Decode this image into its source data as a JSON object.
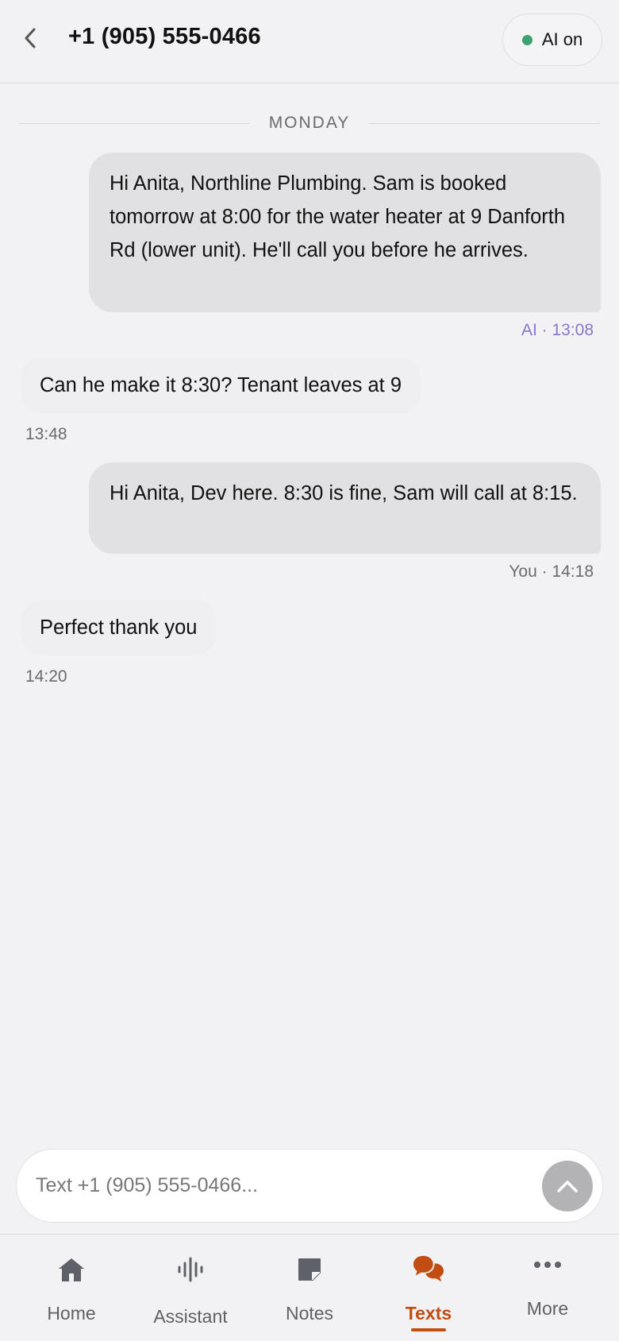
{
  "header": {
    "back_icon": "chevron-left-icon",
    "title": "+1 (905) 555-0466",
    "ai_toggle_label": "AI on",
    "ai_status_color": "#3ca36f"
  },
  "thread": {
    "day_label": "MONDAY",
    "messages": [
      {
        "direction": "outgoing",
        "text": "Hi Anita, Northline Plumbing. Sam is booked tomorrow at 8:00 for the water heater at 9 Danforth Rd (lower unit). He'll call you before he arrives.",
        "meta": "AI · 13:08",
        "sender": "AI"
      },
      {
        "direction": "incoming",
        "text": "Can he make it 8:30? Tenant leaves at 9",
        "meta": "13:48"
      },
      {
        "direction": "outgoing",
        "text": "Hi Anita, Dev here. 8:30 is fine, Sam will call at 8:15.",
        "meta": "You · 14:18",
        "sender": "You"
      },
      {
        "direction": "incoming",
        "text": "Perfect thank you",
        "meta": "14:20"
      }
    ]
  },
  "composer": {
    "placeholder": "Text +1 (905) 555-0466...",
    "value": "",
    "send_icon": "chevron-up-icon"
  },
  "nav": {
    "items": [
      {
        "label": "Home",
        "icon": "home-icon",
        "active": false
      },
      {
        "label": "Assistant",
        "icon": "waveform-icon",
        "active": false
      },
      {
        "label": "Notes",
        "icon": "note-icon",
        "active": false
      },
      {
        "label": "Texts",
        "icon": "chat-bubbles-icon",
        "active": true
      },
      {
        "label": "More",
        "icon": "more-dots-icon",
        "active": false
      }
    ],
    "active_color": "#c24d10"
  }
}
